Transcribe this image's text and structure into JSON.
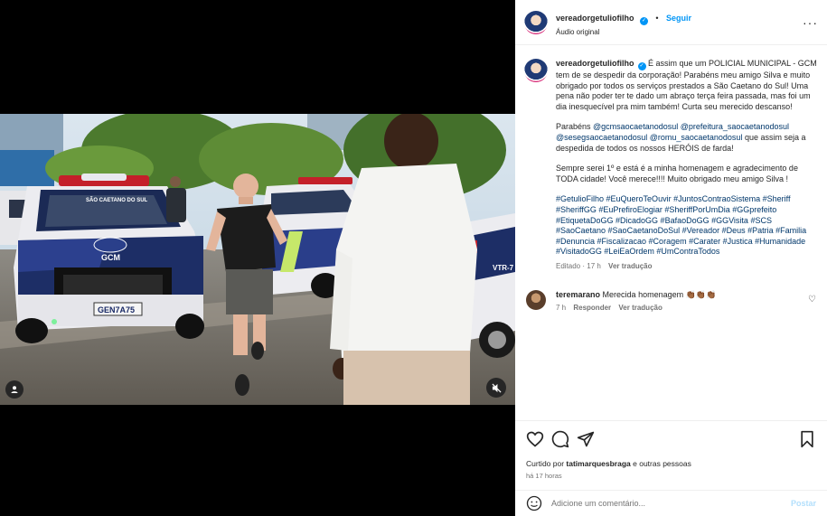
{
  "post": {
    "username": "vereadorgetuliofilho",
    "dot": "•",
    "follow_label": "Seguir",
    "audio": "Áudio original",
    "more": "···"
  },
  "caption": {
    "username": "vereadorgetuliofilho",
    "text1": "É assim que um POLICIAL MUNICIPAL - GCM tem de se despedir da corporação! Parabéns meu amigo Silva e muito obrigado por todos os serviços prestados a São Caetano do Sul! Uma pena não poder ter te dado um abraço terça feira passada, mas foi um dia inesquecível pra mim também! Curta seu merecido descanso!",
    "p2_start": "Parabéns ",
    "mention1": "@gcmsaocaetanodosul",
    "mention2": "@prefeitura_saocaetanodosul",
    "mention3": "@sesegsaocaetanodosul",
    "mention4": "@romu_saocaetanodosul",
    "p2_end": " que assim seja a despedida de todos os nossos HERÓIS de farda!",
    "text3": "Sempre serei 1º e está é a minha homenagem e agradecimento de TODA cidade! Você merece!!!! Muito obrigado meu amigo Silva !",
    "hashtags": "#GetulioFilho #EuQueroTeOuvir #JuntosContraoSistema #Sheriff #SheriffGG #EuPrefiroElogiar #SheriffPorUmDia #GGprefeito #EtiquetaDoGG #DicadoGG #BafaoDoGG #GGVisita #SCS #SaoCaetano #SaoCaetanoDoSul #Vereador #Deus #Patria #Familia #Denuncia #Fiscalizacao #Coragem #Carater #Justica #Humanidade #VisitadoGG #LeiEaOrdem #UmContraTodos",
    "edited": "Editado · 17 h",
    "see_translation": "Ver tradução"
  },
  "comment": {
    "username": "teremarano",
    "text": "Merecida homenagem 👏🏾👏🏾👏🏾",
    "time": "7 h",
    "reply": "Responder",
    "see_translation": "Ver tradução"
  },
  "actions": {
    "liked_prefix": "Curtido por ",
    "liked_user": "tatimarquesbraga",
    "liked_suffix": " e outras pessoas",
    "time": "há 17 horas"
  },
  "add_comment": {
    "placeholder": "Adicione um comentário...",
    "post_label": "Postar"
  },
  "video_scene": {
    "vehicle_text": "GCM",
    "door_text": "SÃO CAETANO DO SUL",
    "plate": "GEN7A75",
    "side_text": "VTR-7"
  },
  "colors": {
    "accent": "#0095f6",
    "link": "#00376b",
    "muted": "#737373",
    "text": "#262626",
    "post_disabled": "#b2dffc"
  }
}
